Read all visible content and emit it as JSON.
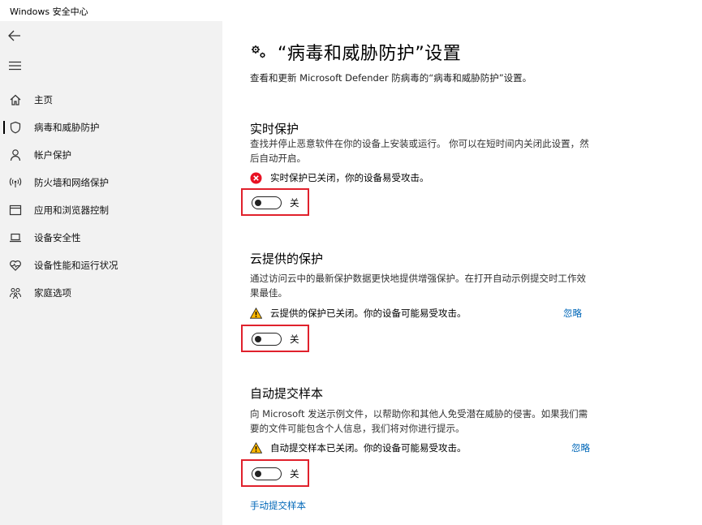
{
  "window": {
    "title": "Windows 安全中心"
  },
  "sidebar": {
    "items": [
      {
        "label": "主页",
        "icon": "home-icon",
        "active": false
      },
      {
        "label": "病毒和威胁防护",
        "icon": "shield-icon",
        "active": true
      },
      {
        "label": "帐户保护",
        "icon": "person-icon",
        "active": false
      },
      {
        "label": "防火墙和网络保护",
        "icon": "wifi-antenna-icon",
        "active": false
      },
      {
        "label": "应用和浏览器控制",
        "icon": "browser-window-icon",
        "active": false
      },
      {
        "label": "设备安全性",
        "icon": "laptop-icon",
        "active": false
      },
      {
        "label": "设备性能和运行状况",
        "icon": "heart-pulse-icon",
        "active": false
      },
      {
        "label": "家庭选项",
        "icon": "family-icon",
        "active": false
      }
    ]
  },
  "main": {
    "title": "“病毒和威胁防护”设置",
    "subtitle": "查看和更新 Microsoft Defender 防病毒的“病毒和威胁防护”设置。",
    "sections": [
      {
        "title": "实时保护",
        "desc": "查找并停止恶意软件在你的设备上安装或运行。 你可以在短时间内关闭此设置，然后自动开启。",
        "status": "实时保护已关闭，你的设备易受攻击。",
        "status_type": "error",
        "dismiss": "",
        "toggle_state": "关"
      },
      {
        "title": "云提供的保护",
        "desc": "通过访问云中的最新保护数据更快地提供增强保护。在打开自动示例提交时工作效果最佳。",
        "status": "云提供的保护已关闭。你的设备可能易受攻击。",
        "status_type": "warning",
        "dismiss": "忽略",
        "toggle_state": "关"
      },
      {
        "title": "自动提交样本",
        "desc": "向 Microsoft 发送示例文件，以帮助你和其他人免受潜在威胁的侵害。如果我们需要的文件可能包含个人信息，我们将对你进行提示。",
        "status": "自动提交样本已关闭。你的设备可能易受攻击。",
        "status_type": "warning",
        "dismiss": "忽略",
        "toggle_state": "关"
      }
    ],
    "manual_submit_link": "手动提交样本"
  },
  "colors": {
    "accent": "#0067b8",
    "error": "#e81123",
    "warning": "#ffb900",
    "highlight_border": "#e0212c",
    "sidebar_bg": "#f2f2f2"
  }
}
